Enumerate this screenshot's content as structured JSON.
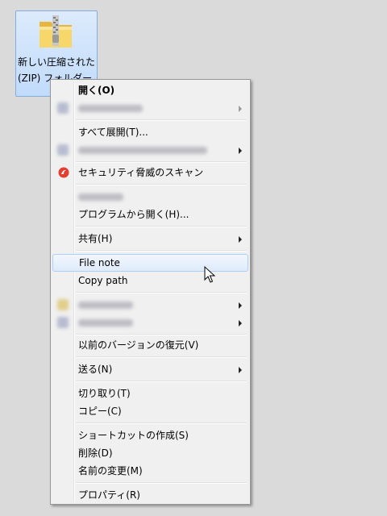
{
  "desktop_icon": {
    "label_line1": "新しい圧縮された",
    "label_line2": "(ZIP) フォルダー.",
    "icon": "zip-folder-icon"
  },
  "context_menu": {
    "open": "開く(O)",
    "extract_all": "すべて展開(T)...",
    "security_scan": "セキュリティ脅威のスキャン",
    "open_with": "プログラムから開く(H)...",
    "share": "共有(H)",
    "file_note": "File note",
    "copy_path": "Copy path",
    "restore_previous": "以前のバージョンの復元(V)",
    "send_to": "送る(N)",
    "cut": "切り取り(T)",
    "copy": "コピー(C)",
    "create_shortcut": "ショートカットの作成(S)",
    "delete": "削除(D)",
    "rename": "名前の変更(M)",
    "properties": "プロパティ(R)"
  },
  "colors": {
    "highlight_border": "#aecff7",
    "scan_icon": "#e53d2f"
  }
}
